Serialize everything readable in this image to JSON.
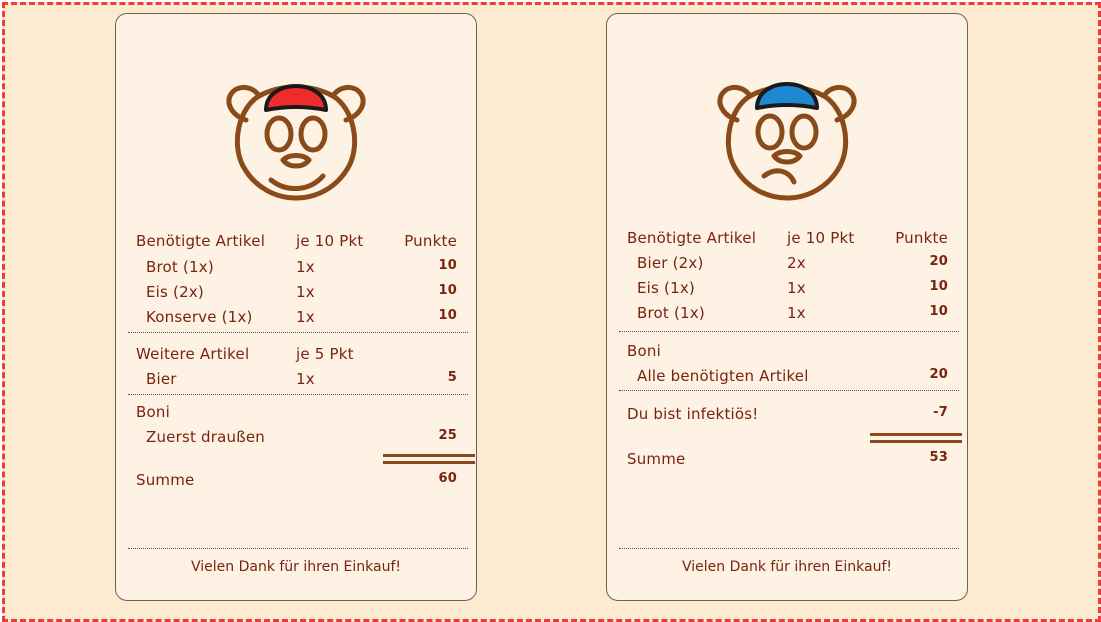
{
  "colors": {
    "frame_border": "#ef3b3b",
    "background": "#fdebd1",
    "receipt": "#fdf2e3",
    "text": "#7a2410",
    "bear": "#8a4a1a",
    "cap_left": "#ef2b2d",
    "cap_right": "#1e88d0"
  },
  "left": {
    "icon": "bear-red-cap-icon",
    "header": {
      "col1": "Benötigte Artikel",
      "col2": "je 10 Pkt",
      "col3": "Punkte"
    },
    "needed": [
      {
        "name": "Brot (1x)",
        "qty": "1x",
        "pts": "10"
      },
      {
        "name": "Eis (2x)",
        "qty": "1x",
        "pts": "10"
      },
      {
        "name": "Konserve (1x)",
        "qty": "1x",
        "pts": "10"
      }
    ],
    "extra_header": {
      "col1": "Weitere Artikel",
      "col2": "je 5 Pkt"
    },
    "extra": [
      {
        "name": "Bier",
        "qty": "1x",
        "pts": "5"
      }
    ],
    "bonus_header": "Boni",
    "bonus": [
      {
        "name": "Zuerst draußen",
        "pts": "25"
      }
    ],
    "sum_label": "Summe",
    "sum_value": "60",
    "footer": "Vielen Dank für ihren Einkauf!"
  },
  "right": {
    "icon": "bear-blue-cap-icon",
    "header": {
      "col1": "Benötigte Artikel",
      "col2": "je 10 Pkt",
      "col3": "Punkte"
    },
    "needed": [
      {
        "name": "Bier (2x)",
        "qty": "2x",
        "pts": "20"
      },
      {
        "name": "Eis (1x)",
        "qty": "1x",
        "pts": "10"
      },
      {
        "name": "Brot (1x)",
        "qty": "1x",
        "pts": "10"
      }
    ],
    "bonus_header": "Boni",
    "bonus": [
      {
        "name": "Alle benötigten Artikel",
        "pts": "20"
      }
    ],
    "penalty": {
      "name": "Du bist infektiös!",
      "pts": "-7"
    },
    "sum_label": "Summe",
    "sum_value": "53",
    "footer": "Vielen Dank für ihren Einkauf!"
  }
}
